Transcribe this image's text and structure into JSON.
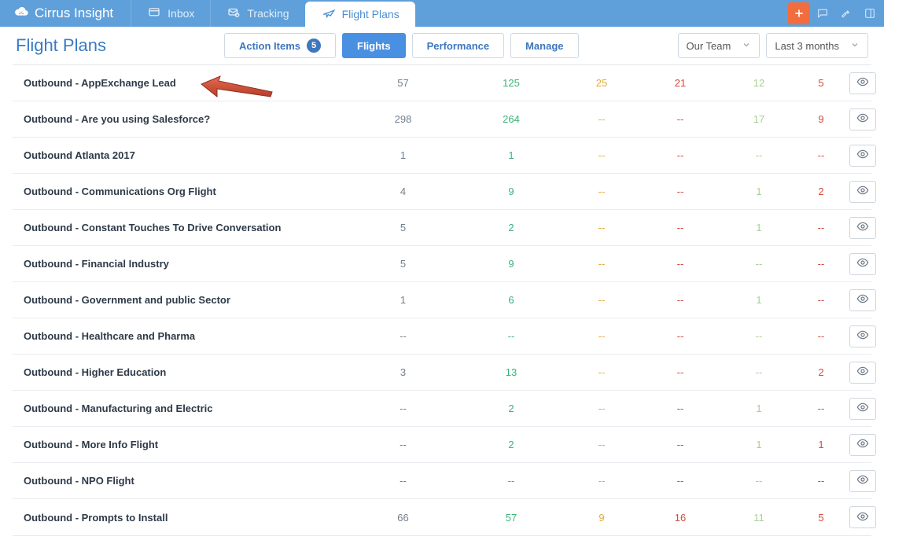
{
  "brand": "Cirrus Insight",
  "topnav": {
    "inbox": "Inbox",
    "tracking": "Tracking",
    "flightplans": "Flight Plans"
  },
  "page_title": "Flight Plans",
  "tabs": {
    "action_items": "Action Items",
    "action_items_count": "5",
    "flights": "Flights",
    "performance": "Performance",
    "manage": "Manage"
  },
  "filters": {
    "team": "Our Team",
    "period": "Last 3 months"
  },
  "rows": [
    {
      "name": "Outbound - AppExchange Lead",
      "c1": "57",
      "c2": "125",
      "c3": "25",
      "c4": "21",
      "c5": "12",
      "c6": "5"
    },
    {
      "name": "Outbound - Are you using Salesforce?",
      "c1": "298",
      "c2": "264",
      "c3": "--",
      "c4": "--",
      "c5": "17",
      "c6": "9"
    },
    {
      "name": "Outbound Atlanta 2017",
      "c1": "1",
      "c2": "1",
      "c3": "--",
      "c4": "--",
      "c5": "--",
      "c6": "--"
    },
    {
      "name": "Outbound - Communications Org Flight",
      "c1": "4",
      "c2": "9",
      "c3": "--",
      "c4": "--",
      "c5": "1",
      "c6": "2"
    },
    {
      "name": "Outbound - Constant Touches To Drive Conversation",
      "c1": "5",
      "c2": "2",
      "c3": "--",
      "c4": "--",
      "c5": "1",
      "c6": "--"
    },
    {
      "name": "Outbound - Financial Industry",
      "c1": "5",
      "c2": "9",
      "c3": "--",
      "c4": "--",
      "c5": "--",
      "c6": "--"
    },
    {
      "name": "Outbound - Government and public Sector",
      "c1": "1",
      "c2": "6",
      "c3": "--",
      "c4": "--",
      "c5": "1",
      "c6": "--"
    },
    {
      "name": "Outbound - Healthcare and Pharma",
      "c1": "--",
      "c2": "--",
      "c3": "--",
      "c4": "--",
      "c5": "--",
      "c6": "--"
    },
    {
      "name": "Outbound - Higher Education",
      "c1": "3",
      "c2": "13",
      "c3": "--",
      "c4": "--",
      "c5": "--",
      "c6": "2"
    },
    {
      "name": "Outbound - Manufacturing and Electric",
      "c1": "--",
      "c2": "2",
      "c3": "--",
      "c4": "--",
      "c5": "1",
      "c6": "--"
    },
    {
      "name": "Outbound - More Info Flight",
      "c1": "--",
      "c2": "2",
      "c3": "--",
      "c4": "--",
      "c5": "1",
      "c6": "1"
    },
    {
      "name": "Outbound - NPO Flight",
      "c1": "--",
      "c2": "--",
      "c3": "--",
      "c4": "--",
      "c5": "--",
      "c6": "--"
    },
    {
      "name": "Outbound - Prompts to Install",
      "c1": "66",
      "c2": "57",
      "c3": "9",
      "c4": "16",
      "c5": "11",
      "c6": "5"
    }
  ]
}
